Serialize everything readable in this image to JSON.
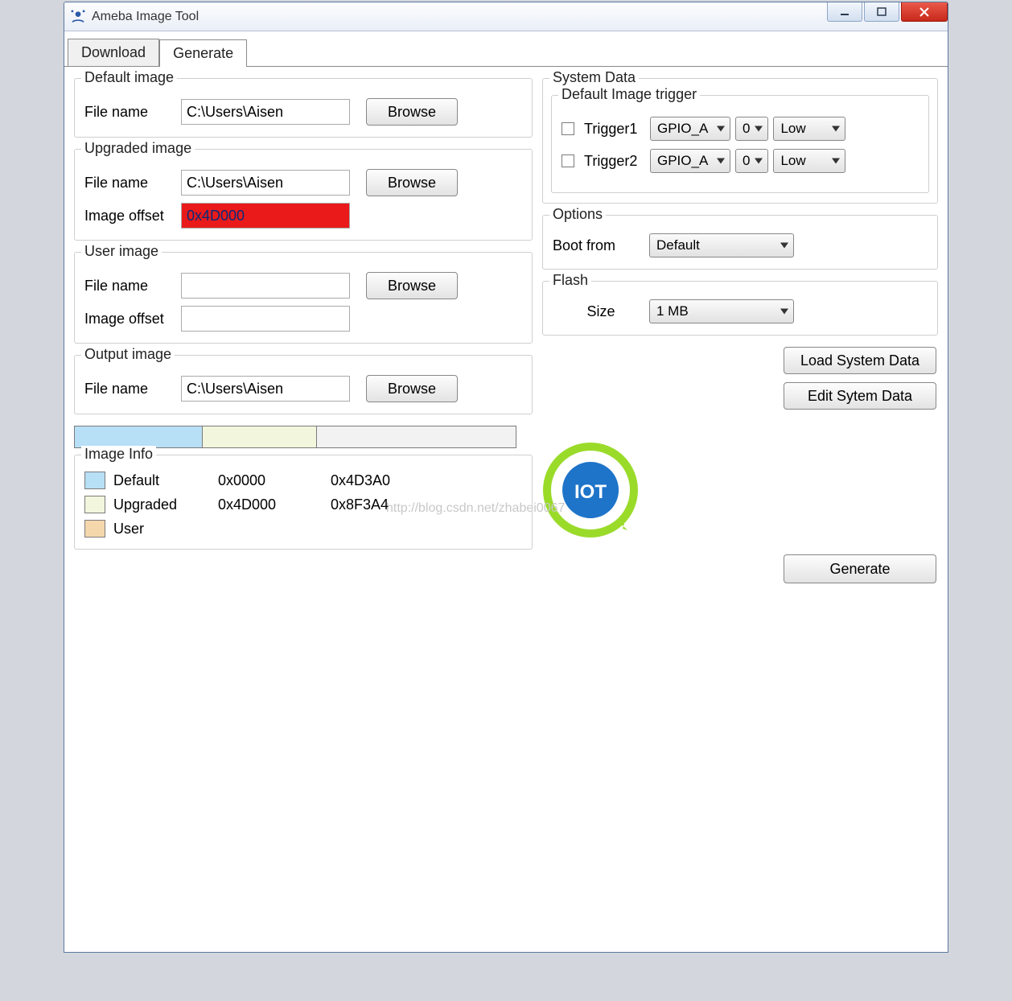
{
  "window": {
    "title": "Ameba Image Tool"
  },
  "tabs": {
    "download": "Download",
    "generate": "Generate",
    "active": "generate"
  },
  "groups": {
    "default_image": {
      "legend": "Default image",
      "file_label": "File name",
      "file_value": "C:\\Users\\Aisen",
      "browse": "Browse"
    },
    "upgraded_image": {
      "legend": "Upgraded image",
      "file_label": "File name",
      "file_value": "C:\\Users\\Aisen",
      "browse": "Browse",
      "offset_label": "Image offset",
      "offset_value": "0x4D000"
    },
    "user_image": {
      "legend": "User image",
      "file_label": "File name",
      "file_value": "",
      "browse": "Browse",
      "offset_label": "Image offset",
      "offset_value": ""
    },
    "output_image": {
      "legend": "Output image",
      "file_label": "File name",
      "file_value": "C:\\Users\\Aisen",
      "browse": "Browse"
    },
    "image_info": {
      "legend": "Image Info"
    }
  },
  "membar": {
    "default_pct": 29,
    "upgraded_pct": 26,
    "user_pct": 45
  },
  "image_info": {
    "rows": [
      {
        "name": "Default",
        "start": "0x0000",
        "end": "0x4D3A0"
      },
      {
        "name": "Upgraded",
        "start": "0x4D000",
        "end": "0x8F3A4"
      },
      {
        "name": "User",
        "start": "",
        "end": ""
      }
    ]
  },
  "system_data": {
    "legend": "System Data",
    "trigger_group": "Default Image trigger",
    "trigger1": {
      "label": "Trigger1",
      "port": "GPIO_A",
      "pin": "0",
      "level": "Low",
      "checked": false
    },
    "trigger2": {
      "label": "Trigger2",
      "port": "GPIO_A",
      "pin": "0",
      "level": "Low",
      "checked": false
    }
  },
  "options": {
    "legend": "Options",
    "boot_label": "Boot from",
    "boot_value": "Default"
  },
  "flash": {
    "legend": "Flash",
    "size_label": "Size",
    "size_value": "1 MB"
  },
  "buttons": {
    "load_sys": "Load System Data",
    "edit_sys": "Edit Sytem Data",
    "generate": "Generate"
  },
  "watermark": "http://blog.csdn.net/zhabei0067"
}
